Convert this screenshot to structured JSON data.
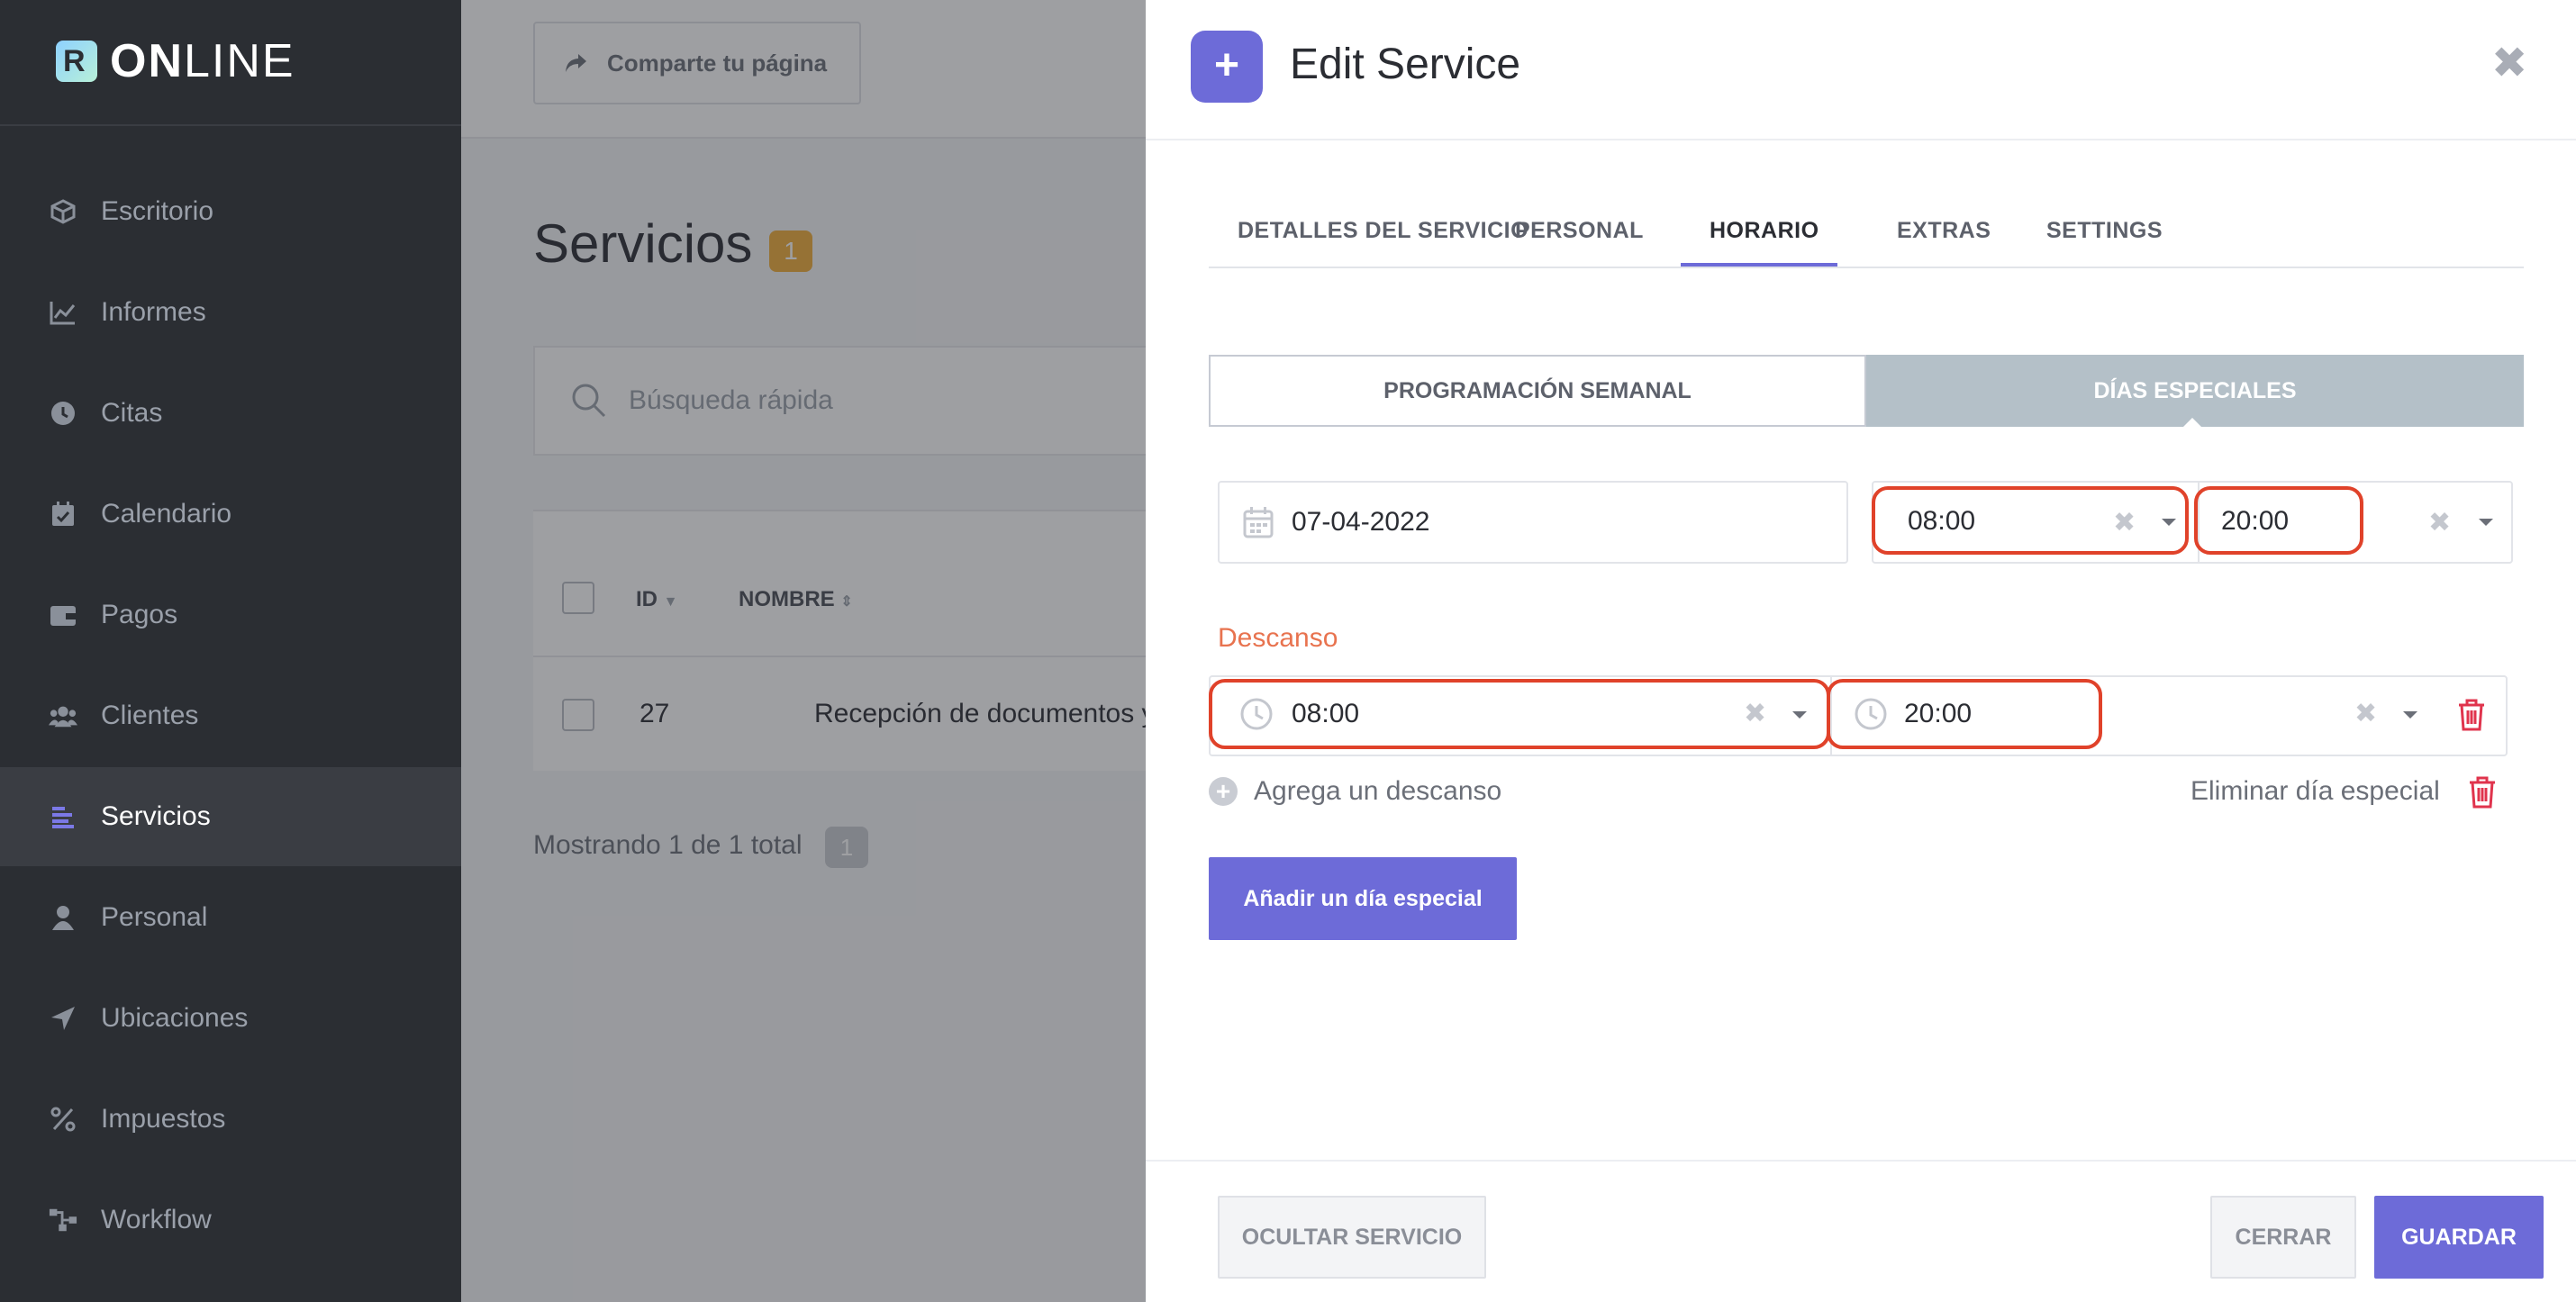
{
  "brand": {
    "logo_letter": "R",
    "name_bold": "ON",
    "name_thin": "LINE"
  },
  "sidebar": {
    "items": [
      {
        "label": "Escritorio",
        "icon": "cube-icon"
      },
      {
        "label": "Informes",
        "icon": "chart-line-icon"
      },
      {
        "label": "Citas",
        "icon": "clock-icon"
      },
      {
        "label": "Calendario",
        "icon": "calendar-icon"
      },
      {
        "label": "Pagos",
        "icon": "wallet-icon"
      },
      {
        "label": "Clientes",
        "icon": "users-icon"
      },
      {
        "label": "Servicios",
        "icon": "list-icon",
        "active": true
      },
      {
        "label": "Personal",
        "icon": "user-icon"
      },
      {
        "label": "Ubicaciones",
        "icon": "location-arrow-icon"
      },
      {
        "label": "Impuestos",
        "icon": "percent-icon"
      },
      {
        "label": "Workflow",
        "icon": "workflow-icon"
      }
    ]
  },
  "main": {
    "share_label": "Comparte tu página",
    "title": "Servicios",
    "count": "1",
    "search_placeholder": "Búsqueda rápida",
    "table": {
      "headers": [
        "ID",
        "NOMBRE"
      ],
      "rows": [
        {
          "id": "27",
          "name": "Recepción de documentos y pa"
        }
      ]
    },
    "showing_text": "Mostrando 1 de 1 total",
    "showing_count": "1"
  },
  "modal": {
    "title": "Edit Service",
    "tabs": [
      "DETALLES DEL SERVICIO",
      "PERSONAL",
      "HORARIO",
      "EXTRAS",
      "SETTINGS"
    ],
    "active_tab": "HORARIO",
    "segments": [
      "PROGRAMACIÓN SEMANAL",
      "DÍAS ESPECIALES"
    ],
    "active_segment": "DÍAS ESPECIALES",
    "special_day": {
      "date": "07-04-2022",
      "start": "08:00",
      "end": "20:00"
    },
    "break_label": "Descanso",
    "break": {
      "start": "08:00",
      "end": "20:00"
    },
    "add_break_label": "Agrega un descanso",
    "remove_day_label": "Eliminar día especial",
    "add_special_day_label": "Añadir un día especial",
    "footer": {
      "hide_label": "OCULTAR SERVICIO",
      "close_label": "CERRAR",
      "save_label": "GUARDAR"
    }
  },
  "colors": {
    "sidebar_bg": "#2b2e33",
    "accent": "#6d6bd8",
    "highlight": "#e0422a",
    "badge": "#f0ad3a",
    "break_label": "#e8734f",
    "delete": "#e0344d"
  }
}
